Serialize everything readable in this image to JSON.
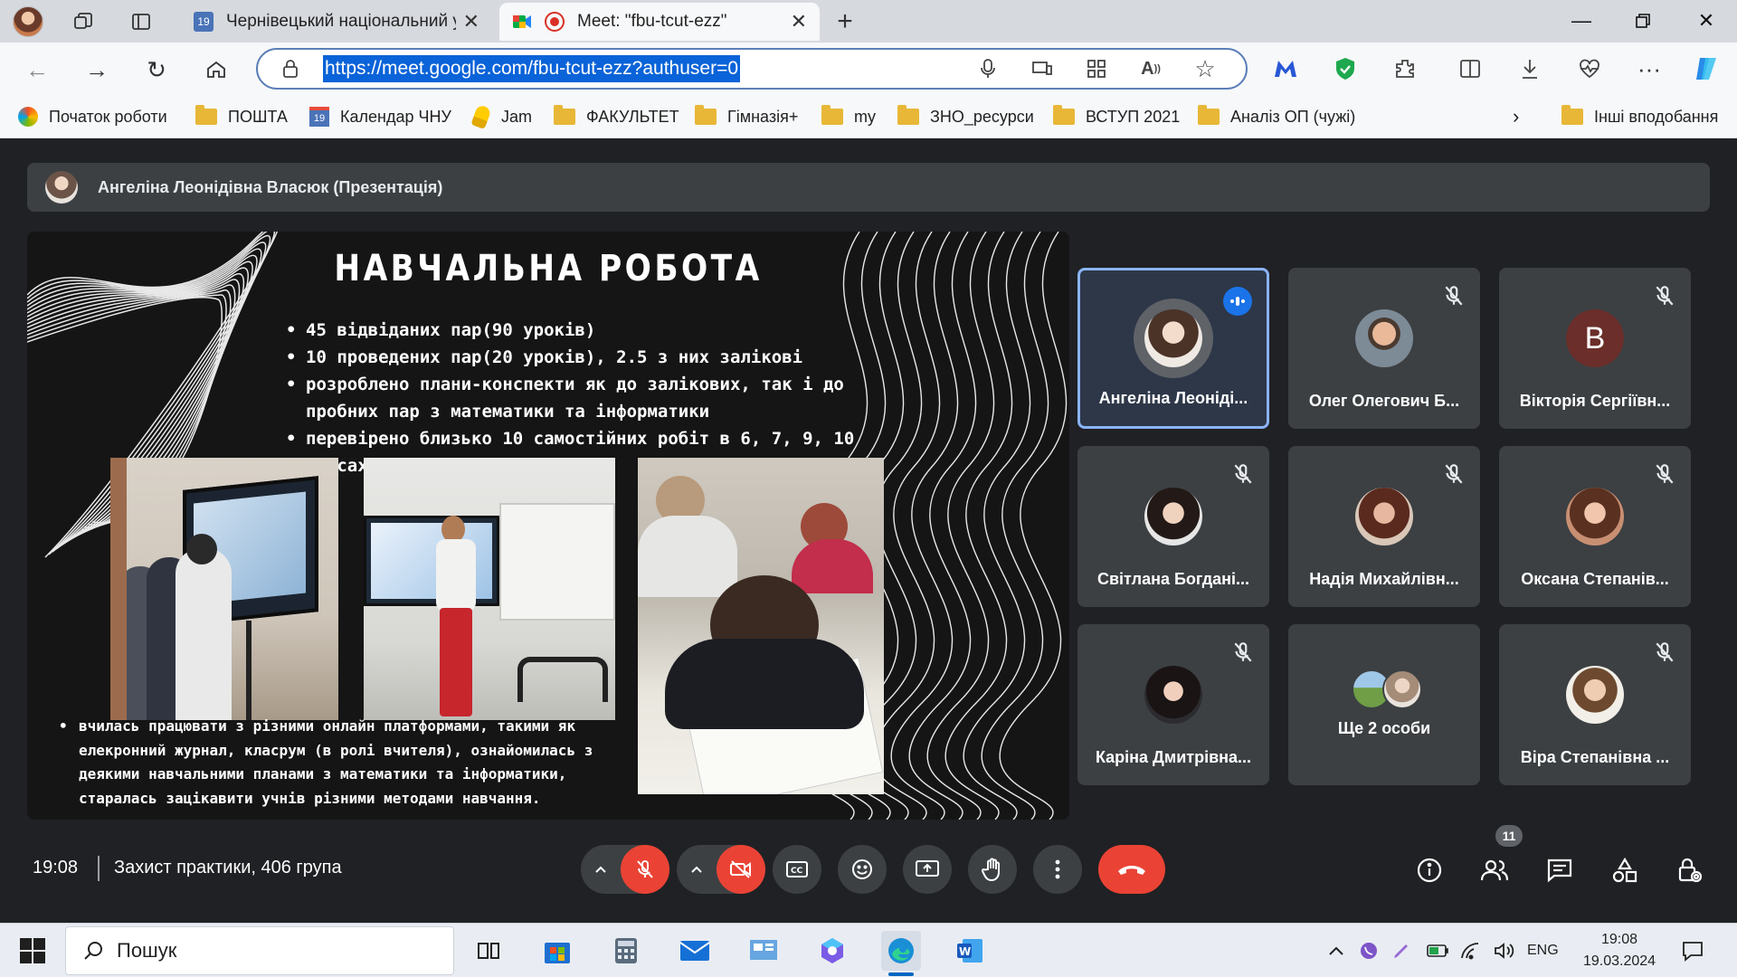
{
  "browser": {
    "tabs": [
      {
        "title": "Чернівецький національний ун",
        "active": false
      },
      {
        "title": "Meet: \"fbu-tcut-ezz\"",
        "active": true
      }
    ],
    "url": "https://meet.google.com/fbu-tcut-ezz?authuser=0",
    "bookmarks": [
      {
        "label": "Початок роботи",
        "icon": "edge-start-icon"
      },
      {
        "label": "ПОШТА",
        "icon": "folder-icon"
      },
      {
        "label": "Календар ЧНУ",
        "icon": "calendar-icon"
      },
      {
        "label": "Jam",
        "icon": "jam-icon"
      },
      {
        "label": "ФАКУЛЬТЕТ",
        "icon": "folder-icon"
      },
      {
        "label": "Гімназія+",
        "icon": "folder-icon"
      },
      {
        "label": "my",
        "icon": "folder-icon"
      },
      {
        "label": "ЗНО_ресурси",
        "icon": "folder-icon"
      },
      {
        "label": "ВСТУП 2021",
        "icon": "folder-icon"
      },
      {
        "label": "Аналіз ОП (чужі)",
        "icon": "folder-icon"
      }
    ],
    "other_bookmarks": "Інші вподобання",
    "calendar_day": "19"
  },
  "meet": {
    "presenter_banner": "Ангеліна Леонідівна Власюк (Презентація)",
    "slide": {
      "title": "НАВЧАЛЬНА РОБОТА",
      "bullets": [
        "45 відвіданих пар(90 уроків)",
        "10 проведених пар(20 уроків), 2.5 з них залікові",
        "розроблено плани-конспекти як до залікових, так і до пробних пар з математики та інформатики",
        "перевірено близько 10 самостійних робіт в 6, 7, 9, 10 класах"
      ],
      "bottom_bullet": "вчилась працювати з різними онлайн платформами, такими як елекронний журнал, класрум (в ролі вчителя), ознайомилась з деякими навчальними планами з математики та інформатики, старалась зацікавити учнів різними методами навчання."
    },
    "participants": [
      {
        "name": "Ангеліна Леоніді...",
        "speaking": true,
        "muted": false
      },
      {
        "name": "Олег Олегович Б...",
        "speaking": false,
        "muted": true
      },
      {
        "name": "Вікторія Сергіївн...",
        "speaking": false,
        "muted": true,
        "letter": "В"
      },
      {
        "name": "Світлана Богдані...",
        "speaking": false,
        "muted": true
      },
      {
        "name": "Надія Михайлівн...",
        "speaking": false,
        "muted": true
      },
      {
        "name": "Оксана Степанів...",
        "speaking": false,
        "muted": true
      },
      {
        "name": "Каріна Дмитрівна...",
        "speaking": false,
        "muted": true
      },
      {
        "name": "Ще 2 особи",
        "speaking": false,
        "muted": false
      },
      {
        "name": "Віра Степанівна ...",
        "speaking": false,
        "muted": true
      }
    ],
    "time": "19:08",
    "meeting_title": "Захист практики, 406 група",
    "people_count": "11"
  },
  "taskbar": {
    "search_label": "Пошук",
    "language": "ENG",
    "clock_time": "19:08",
    "clock_date": "19.03.2024"
  },
  "colors": {
    "accent": "#1a73e8",
    "hangup": "#ea4335",
    "tile_bg": "#3c4043",
    "speaking_border": "#8ab4f8"
  }
}
